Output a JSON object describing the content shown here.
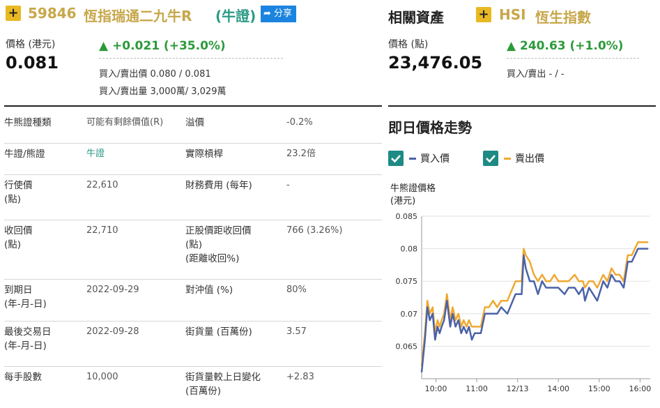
{
  "left": {
    "code": "59846",
    "name": "恆指瑞通二九牛R",
    "type_tag": "(牛證)",
    "share_label": "分享",
    "price_label": "價格 (港元)",
    "price": "0.081",
    "change": "+0.021 (+35.0%)",
    "bid_ask_label": "買入/賣出價",
    "bid_ask_value": "0.080 / 0.081",
    "bid_ask_vol_label": "買入/賣出量",
    "bid_ask_vol_value": "3,000萬/ 3,029萬"
  },
  "right": {
    "related_title": "相關資產",
    "asset_code": "HSI",
    "asset_name": "恆生指數",
    "price_label": "價格 (點)",
    "price": "23,476.05",
    "change": "240.63 (+1.0%)",
    "bid_ask_label": "買入/賣出",
    "bid_ask_value": "- / -"
  },
  "table": {
    "rows": [
      {
        "k1": "牛熊證種類",
        "v1": "可能有剩餘價值(R)",
        "k2": "溢價",
        "v2": "-0.2%"
      },
      {
        "k1": "牛證/熊證",
        "v1": "牛證",
        "k2": "實際槓桿",
        "v2": "23.2倍"
      },
      {
        "k1": "行使價\n(點)",
        "v1": "22,610",
        "k2": "財務費用 (每年)",
        "v2": "-"
      },
      {
        "k1": "收回價\n(點)",
        "v1": "22,710",
        "k2": "正股價距收回價\n(點)\n(距離收回%)",
        "v2": "766 (3.26%)"
      },
      {
        "k1": "到期日\n(年-月-日)",
        "v1": "2022-09-29",
        "k2": "對沖值 (%)",
        "v2": "80%"
      },
      {
        "k1": "最後交易日\n(年-月-日)",
        "v1": "2022-09-28",
        "k2": "街貨量 (百萬份)",
        "v2": "3.57"
      },
      {
        "k1": "每手股數",
        "v1": "10,000",
        "k2": "街貨量較上日變化\n(百萬份)",
        "v2": "+2.83"
      }
    ]
  },
  "chart_panel": {
    "title": "即日價格走勢",
    "legend_bid": "買入價",
    "legend_ask": "賣出價",
    "colors": {
      "bid": "#4a62a8",
      "ask": "#f0a830",
      "grid": "#e2e2e2"
    }
  },
  "chart_data": {
    "type": "line",
    "ylabel": "牛熊證價格\n(港元)",
    "ylim": [
      0.06,
      0.085
    ],
    "yticks": [
      "0.065",
      "0.07",
      "0.075",
      "0.08",
      "0.085"
    ],
    "ytick_values": [
      0.065,
      0.07,
      0.075,
      0.08,
      0.085
    ],
    "xticks": [
      "10:00",
      "11:00",
      "12/13",
      "14:00",
      "15:00",
      "16:00"
    ],
    "xtick_values": [
      0.35,
      1.35,
      2.35,
      3.35,
      4.35,
      5.35
    ],
    "xlim": [
      0,
      5.6
    ],
    "series": [
      {
        "name": "買入價",
        "x": [
          0,
          0.08,
          0.14,
          0.2,
          0.27,
          0.33,
          0.39,
          0.44,
          0.49,
          0.55,
          0.62,
          0.7,
          0.76,
          0.83,
          0.9,
          0.97,
          1.03,
          1.1,
          1.16,
          1.23,
          1.3,
          1.37,
          1.45,
          1.55,
          1.65,
          1.75,
          1.85,
          1.95,
          2.1,
          2.3,
          2.45,
          2.5,
          2.55,
          2.65,
          2.75,
          2.85,
          2.95,
          3.05,
          3.15,
          3.25,
          3.35,
          3.5,
          3.6,
          3.75,
          3.85,
          3.95,
          4.0,
          4.1,
          4.2,
          4.3,
          4.45,
          4.55,
          4.65,
          4.75,
          4.85,
          4.95,
          5.05,
          5.15,
          5.3,
          5.45,
          5.55
        ],
        "y": [
          0.061,
          0.066,
          0.071,
          0.069,
          0.07,
          0.066,
          0.068,
          0.067,
          0.068,
          0.069,
          0.072,
          0.068,
          0.07,
          0.068,
          0.069,
          0.067,
          0.068,
          0.067,
          0.068,
          0.066,
          0.067,
          0.067,
          0.067,
          0.07,
          0.07,
          0.07,
          0.07,
          0.071,
          0.07,
          0.073,
          0.073,
          0.079,
          0.077,
          0.075,
          0.075,
          0.073,
          0.075,
          0.074,
          0.074,
          0.074,
          0.074,
          0.073,
          0.074,
          0.074,
          0.073,
          0.074,
          0.072,
          0.074,
          0.073,
          0.072,
          0.075,
          0.074,
          0.076,
          0.075,
          0.075,
          0.074,
          0.078,
          0.078,
          0.08,
          0.08,
          0.08
        ]
      },
      {
        "name": "賣出價",
        "x": [
          0,
          0.08,
          0.14,
          0.2,
          0.27,
          0.33,
          0.39,
          0.44,
          0.49,
          0.55,
          0.62,
          0.7,
          0.76,
          0.83,
          0.9,
          0.97,
          1.03,
          1.1,
          1.16,
          1.23,
          1.3,
          1.37,
          1.45,
          1.55,
          1.65,
          1.75,
          1.85,
          1.95,
          2.1,
          2.3,
          2.45,
          2.5,
          2.55,
          2.65,
          2.75,
          2.85,
          2.95,
          3.05,
          3.15,
          3.25,
          3.35,
          3.5,
          3.6,
          3.75,
          3.85,
          3.95,
          4.0,
          4.1,
          4.2,
          4.3,
          4.45,
          4.55,
          4.65,
          4.75,
          4.85,
          4.95,
          5.05,
          5.15,
          5.3,
          5.45,
          5.55
        ],
        "y": [
          0.062,
          0.067,
          0.072,
          0.07,
          0.071,
          0.067,
          0.069,
          0.068,
          0.069,
          0.07,
          0.073,
          0.069,
          0.071,
          0.069,
          0.07,
          0.068,
          0.069,
          0.068,
          0.069,
          0.068,
          0.068,
          0.068,
          0.068,
          0.071,
          0.071,
          0.072,
          0.071,
          0.072,
          0.072,
          0.075,
          0.075,
          0.08,
          0.079,
          0.078,
          0.076,
          0.075,
          0.076,
          0.075,
          0.075,
          0.076,
          0.075,
          0.075,
          0.075,
          0.076,
          0.075,
          0.075,
          0.074,
          0.075,
          0.075,
          0.074,
          0.076,
          0.075,
          0.077,
          0.076,
          0.076,
          0.075,
          0.079,
          0.079,
          0.081,
          0.081,
          0.081
        ]
      }
    ]
  }
}
